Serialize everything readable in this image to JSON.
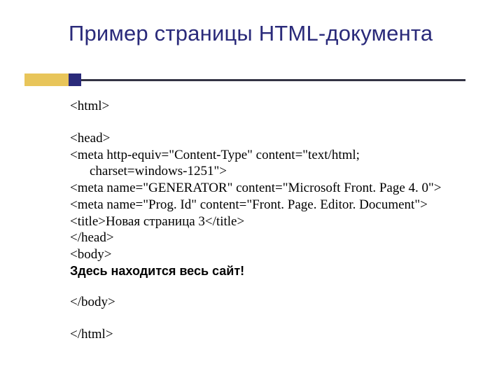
{
  "title": "Пример страницы HTML-документа",
  "lines": {
    "l1": "<html>",
    "l2": "<head>",
    "l3": "<meta http-equiv=\"Content-Type\" content=\"text/html;",
    "l3b": "charset=windows-1251\">",
    "l4": "<meta name=\"GENERATOR\" content=\"Microsoft Front. Page 4. 0\">",
    "l5": "<meta name=\"Prog. Id\" content=\"Front. Page. Editor. Document\">",
    "l6": "<title>Новая страница 3</title>",
    "l7": "</head>",
    "l8": "<body>",
    "l9": "Здесь находится весь сайт!",
    "l10": "</body>",
    "l11": "</html>"
  }
}
